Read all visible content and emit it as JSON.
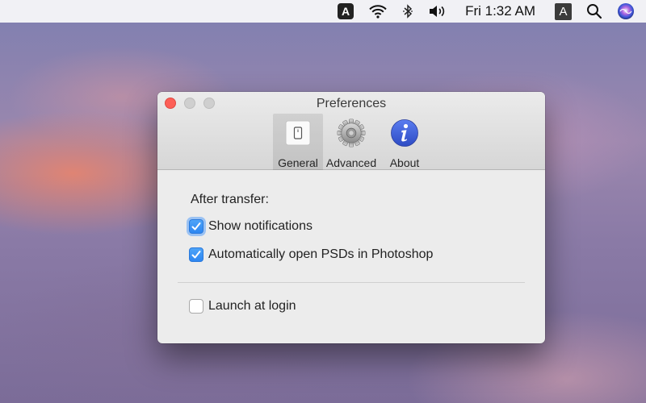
{
  "menubar": {
    "clock": "Fri 1:32 AM",
    "input_source_label": "A",
    "app_badge_label": "A",
    "icons": [
      "app-a-icon",
      "wifi-icon",
      "bluetooth-icon",
      "volume-icon",
      "input-source-icon",
      "search-icon",
      "siri-icon"
    ]
  },
  "window": {
    "title": "Preferences",
    "toolbar": {
      "tabs": [
        {
          "label": "General",
          "icon": "switch-icon",
          "selected": true
        },
        {
          "label": "Advanced",
          "icon": "gear-icon",
          "selected": false
        },
        {
          "label": "About",
          "icon": "info-icon",
          "selected": false
        }
      ]
    },
    "general": {
      "section_heading": "After transfer:",
      "options": [
        {
          "label": "Show notifications",
          "checked": true,
          "focused": true
        },
        {
          "label": "Automatically open PSDs in Photoshop",
          "checked": true,
          "focused": false
        },
        {
          "label": "Launch at login",
          "checked": false,
          "focused": false
        }
      ]
    }
  },
  "colors": {
    "accent": "#2d86f1",
    "close_button": "#fd5f57",
    "info_icon": "#3b5fd9"
  }
}
